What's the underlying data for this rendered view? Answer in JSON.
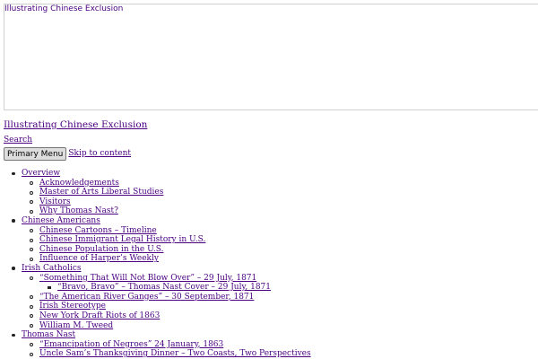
{
  "header": {
    "image_alt": "Illustrating Chinese Exclusion"
  },
  "site": {
    "title": "Illustrating Chinese Exclusion"
  },
  "search_link": "Search",
  "primary_menu_label": "Primary Menu",
  "skip_link": "Skip to content",
  "nav": [
    {
      "label": "Overview",
      "children": [
        {
          "label": "Acknowledgements"
        },
        {
          "label": "Master of Arts Liberal Studies"
        },
        {
          "label": "Visitors"
        },
        {
          "label": "Why Thomas Nast?"
        }
      ]
    },
    {
      "label": "Chinese Americans",
      "children": [
        {
          "label": "Chinese Cartoons – Timeline"
        },
        {
          "label": "Chinese Immigrant Legal History in U.S."
        },
        {
          "label": "Chinese Population in the U.S."
        },
        {
          "label": "Influence of Harper’s Weekly"
        }
      ]
    },
    {
      "label": "Irish Catholics",
      "children": [
        {
          "label": "“Something That Will Not Blow Over” – 29 July, 1871",
          "children": [
            {
              "label": "“Bravo, Bravo” – Thomas Nast Cover – 29 July, 1871"
            }
          ]
        },
        {
          "label": "“The American River Ganges” – 30 September, 1871"
        },
        {
          "label": "Irish Stereotype"
        },
        {
          "label": "New York Draft Riots of 1863"
        },
        {
          "label": "William M. Tweed"
        }
      ]
    },
    {
      "label": "Thomas Nast",
      "children": [
        {
          "label": "“Emancipation of Negroes” 24 January, 1863"
        },
        {
          "label": "Uncle Sam’s Thanksgiving Dinner – Two Coasts, Two Perspectives"
        }
      ]
    }
  ]
}
